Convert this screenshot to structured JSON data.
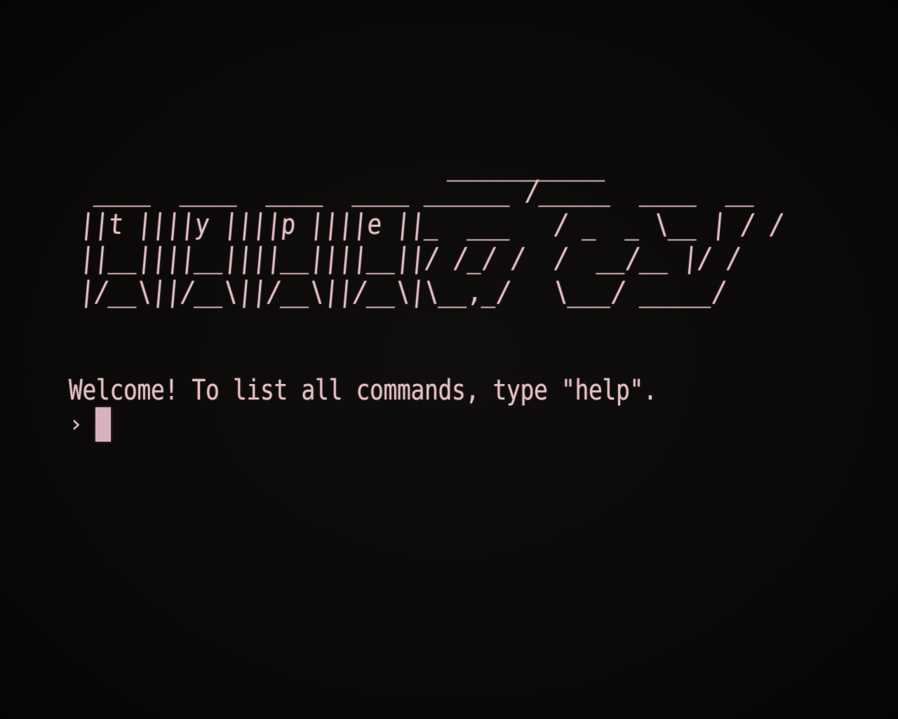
{
  "terminal": {
    "banner_lines": [
      "  ____  ____  ____  ____ ______ /_____  ____  __",
      " ||t ||||y ||||p ||||e ||_  ___   / _  _ \\__ | / /",
      " ||__||||__||||__||||__||/ /_/ /  /  __/__ |/ /",
      " |/__\\||/__\\||/__\\||/__\\|\\__,_/   \\___/ _____/"
    ],
    "banner_overline": "___________",
    "welcome_message": "Welcome! To list all commands, type \"help\".",
    "prompt_symbol": "›",
    "input_value": ""
  },
  "colors": {
    "background": "#0b0a09",
    "text": "#e8c3cb",
    "cursor": "#dbb5bf"
  }
}
